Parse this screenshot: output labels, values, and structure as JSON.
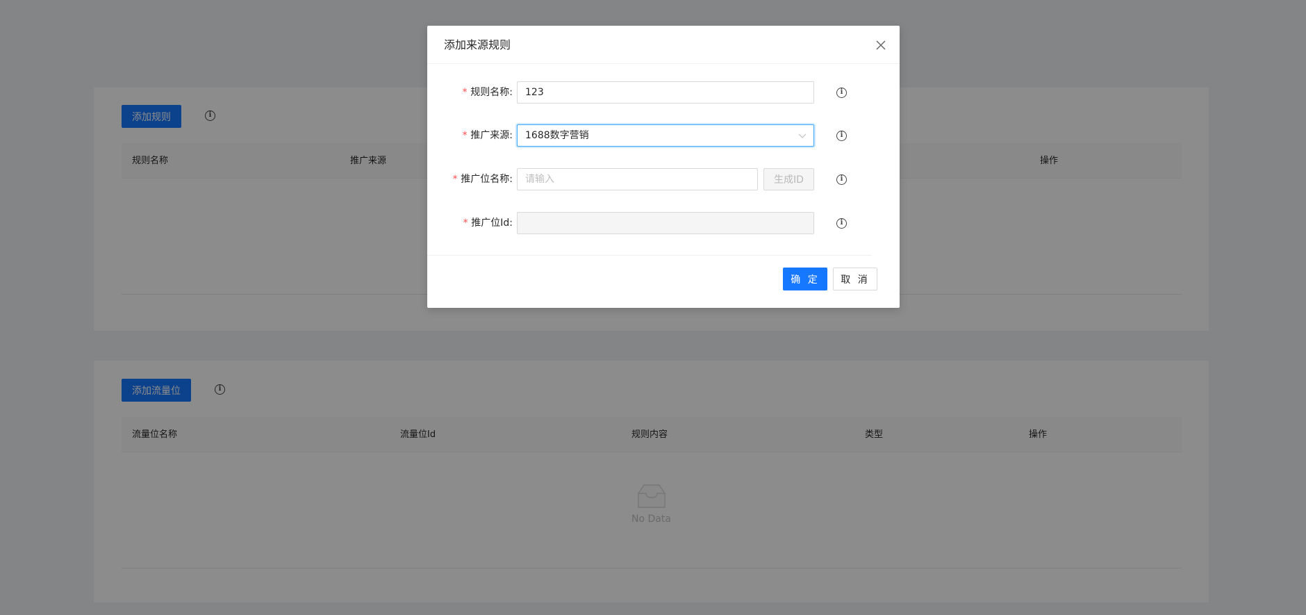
{
  "rules_card": {
    "add_button": "添加规则",
    "columns": [
      "规则名称",
      "推广来源",
      "操作"
    ]
  },
  "traffic_card": {
    "add_button": "添加流量位",
    "columns": [
      "流量位名称",
      "流量位Id",
      "规则内容",
      "类型",
      "操作"
    ],
    "empty_text": "No Data"
  },
  "modal": {
    "title": "添加来源规则",
    "fields": [
      {
        "label": "规则名称:",
        "value": "123",
        "placeholder": ""
      },
      {
        "label": "推广来源:",
        "value": "1688数字营销",
        "placeholder": ""
      },
      {
        "label": "推广位名称:",
        "value": "",
        "placeholder": "请输入"
      },
      {
        "label": "推广位Id:",
        "value": "",
        "placeholder": ""
      }
    ],
    "generate_button": "生成ID",
    "ok_button": "确 定",
    "cancel_button": "取 消"
  }
}
